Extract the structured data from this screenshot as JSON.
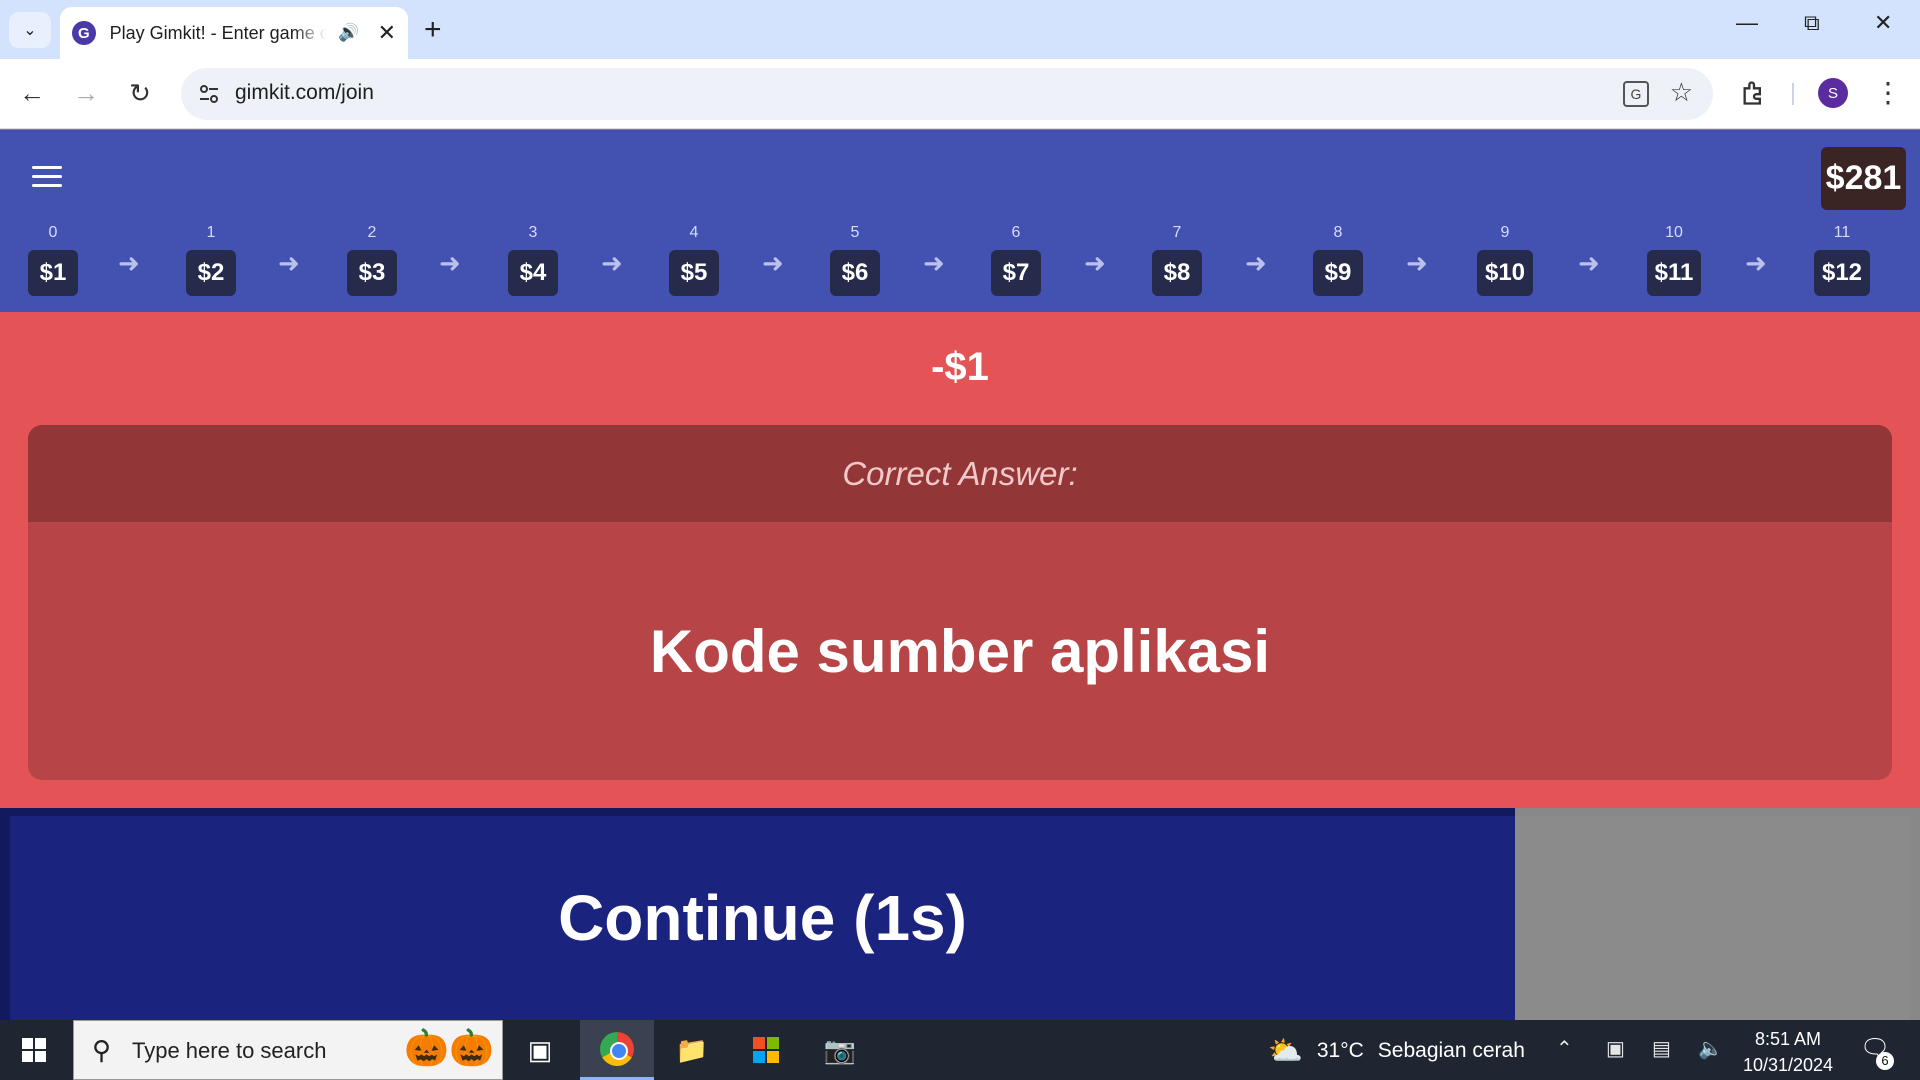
{
  "browser": {
    "tab_title": "Play Gimkit! - Enter game code",
    "favicon_letter": "G",
    "url": "gimkit.com/join",
    "profile_initial": "S"
  },
  "game": {
    "balance": "$281",
    "ladder": [
      {
        "index": "0",
        "price": "$1"
      },
      {
        "index": "1",
        "price": "$2"
      },
      {
        "index": "2",
        "price": "$3"
      },
      {
        "index": "3",
        "price": "$4"
      },
      {
        "index": "4",
        "price": "$5"
      },
      {
        "index": "5",
        "price": "$6"
      },
      {
        "index": "6",
        "price": "$7"
      },
      {
        "index": "7",
        "price": "$8"
      },
      {
        "index": "8",
        "price": "$9"
      },
      {
        "index": "9",
        "price": "$10"
      },
      {
        "index": "10",
        "price": "$11"
      },
      {
        "index": "11",
        "price": "$12"
      }
    ],
    "delta": "-$1",
    "correct_answer_label": "Correct Answer:",
    "correct_answer": "Kode sumber aplikasi",
    "continue_label": "Continue (1s)"
  },
  "taskbar": {
    "search_placeholder": "Type here to search",
    "weather_temp": "31°C",
    "weather_desc": "Sebagian cerah",
    "time": "8:51 AM",
    "date": "10/31/2024",
    "notification_count": "6"
  },
  "colors": {
    "header_bg": "#4351b1",
    "result_bg": "#e45456",
    "continue_bg": "#1a237e"
  }
}
